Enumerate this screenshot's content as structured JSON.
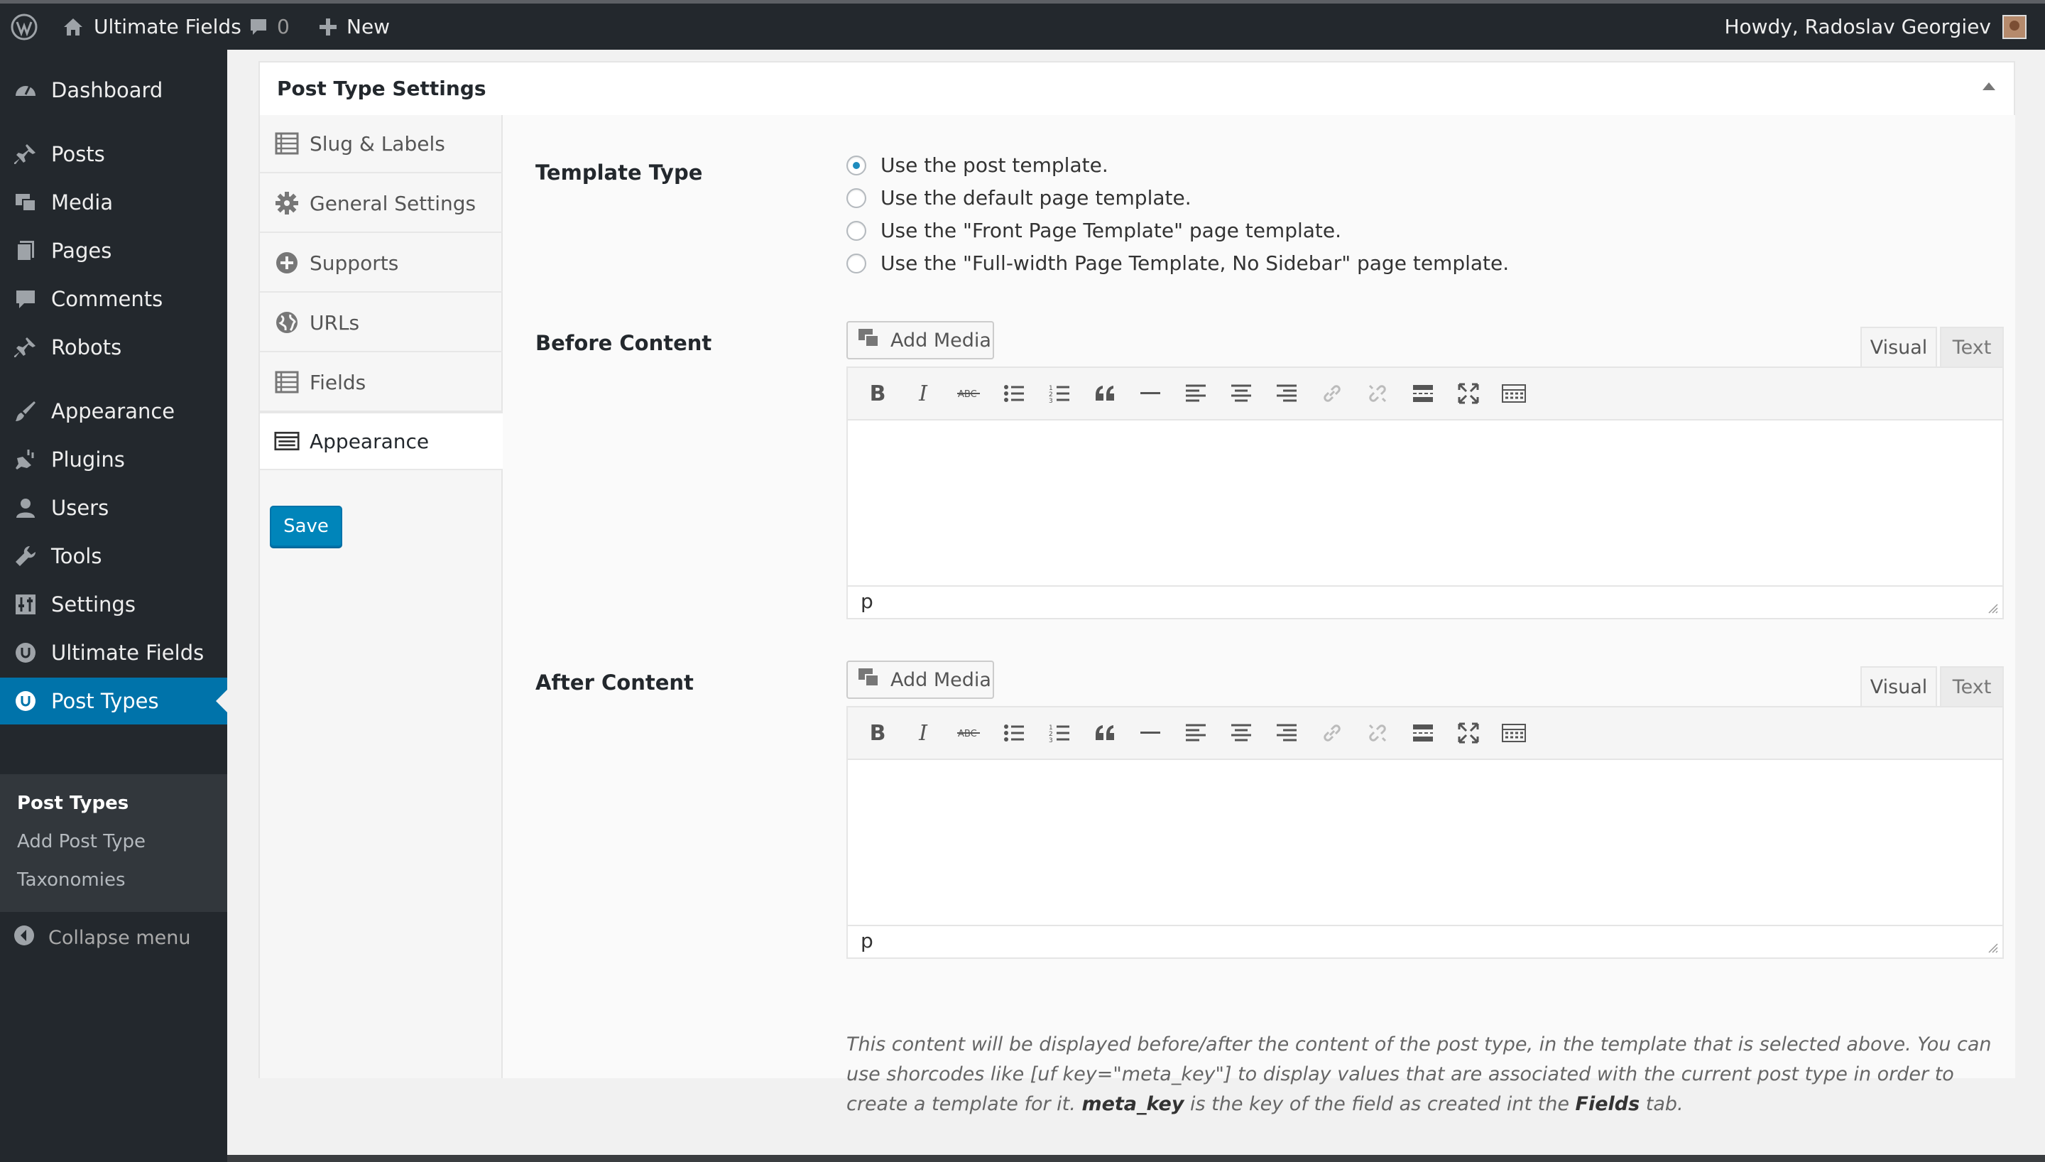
{
  "adminbar": {
    "site_name": "Ultimate Fields",
    "comments_count": "0",
    "new_label": "New",
    "howdy": "Howdy, Radoslav Georgiev"
  },
  "sidebar": {
    "items": [
      {
        "label": "Dashboard",
        "icon": "dashboard-icon"
      },
      {
        "label": "Posts",
        "icon": "pin-icon"
      },
      {
        "label": "Media",
        "icon": "media-icon"
      },
      {
        "label": "Pages",
        "icon": "pages-icon"
      },
      {
        "label": "Comments",
        "icon": "comments-icon"
      },
      {
        "label": "Robots",
        "icon": "pin-icon"
      },
      {
        "label": "Appearance",
        "icon": "brush-icon"
      },
      {
        "label": "Plugins",
        "icon": "plugin-icon"
      },
      {
        "label": "Users",
        "icon": "user-icon"
      },
      {
        "label": "Tools",
        "icon": "wrench-icon"
      },
      {
        "label": "Settings",
        "icon": "settings-icon"
      },
      {
        "label": "Ultimate Fields",
        "icon": "uf-logo-icon"
      },
      {
        "label": "Post Types",
        "icon": "uf-logo-icon",
        "current": true
      }
    ],
    "submenu": [
      "Post Types",
      "Add Post Type",
      "Taxonomies"
    ],
    "collapse": "Collapse menu"
  },
  "postbox": {
    "title": "Post Type Settings",
    "tabs": [
      {
        "label": "Slug & Labels",
        "icon": "list-icon"
      },
      {
        "label": "General Settings",
        "icon": "gear-icon"
      },
      {
        "label": "Supports",
        "icon": "plus-circle-icon"
      },
      {
        "label": "URLs",
        "icon": "globe-icon"
      },
      {
        "label": "Fields",
        "icon": "list-icon"
      },
      {
        "label": "Appearance",
        "icon": "layout-icon",
        "active": true
      }
    ],
    "save_label": "Save"
  },
  "template_type": {
    "label": "Template Type",
    "options": [
      "Use the post template.",
      "Use the default page template.",
      "Use the \"Front Page Template\" page template.",
      "Use the \"Full-width Page Template, No Sidebar\" page template."
    ],
    "selected_index": 0
  },
  "before_content": {
    "label": "Before Content",
    "add_media": "Add Media",
    "visual": "Visual",
    "text": "Text",
    "path": "p"
  },
  "after_content": {
    "label": "After Content",
    "add_media": "Add Media",
    "visual": "Visual",
    "text": "Text",
    "path": "p"
  },
  "description": {
    "part1": "This content will be displayed before/after the content of the post type, in the template that is selected above. You can use shorcodes like [uf key=\"meta_key\"] to display values that are associated with the current post type in order to create a template for it. ",
    "meta_key": "meta_key",
    "part2": " is the key of the field as created int the ",
    "fields": "Fields",
    "part3": " tab."
  },
  "colors": {
    "adminbar": "#23282d",
    "accent": "#0073aa",
    "button": "#0085ba"
  }
}
